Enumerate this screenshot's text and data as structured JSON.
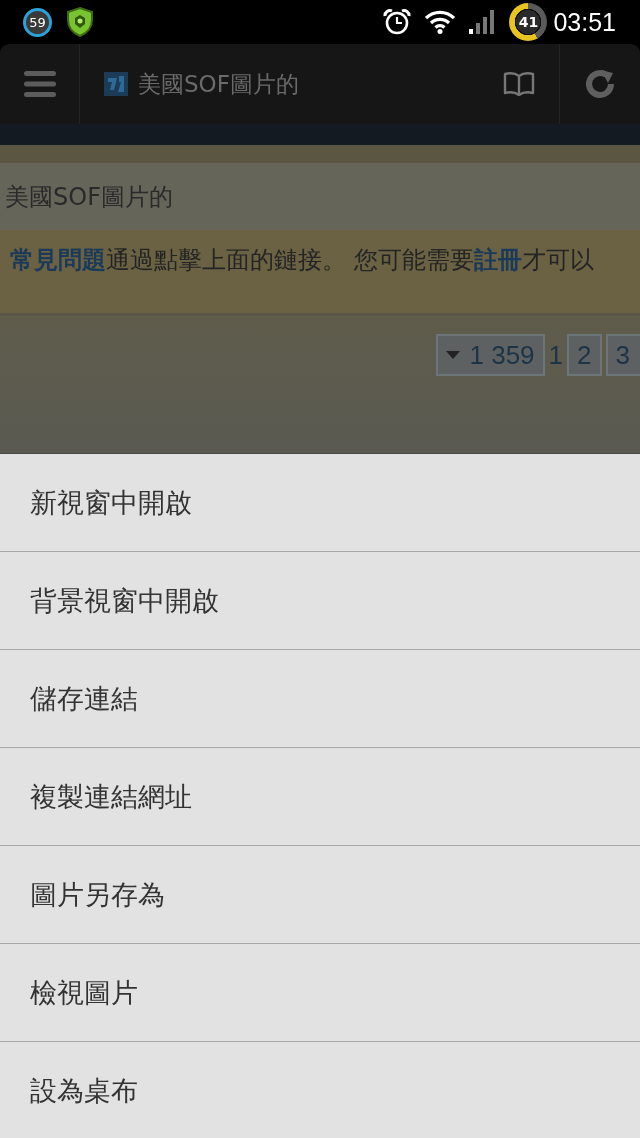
{
  "status_bar": {
    "notification_count": "59",
    "battery": "41",
    "time": "03:51"
  },
  "toolbar": {
    "title": "美國SOF圖片的"
  },
  "page": {
    "title": "美國SOF圖片的",
    "notice": [
      {
        "kind": "link",
        "text": "常見問題"
      },
      {
        "kind": "text",
        "text": "通過點擊上面的鏈接。 您可能需要"
      },
      {
        "kind": "link",
        "text": "註冊"
      },
      {
        "kind": "text",
        "text": "才可以"
      }
    ],
    "pagination": [
      {
        "kind": "jump",
        "label": "1 359"
      },
      {
        "kind": "current",
        "label": "1"
      },
      {
        "kind": "page",
        "label": "2"
      },
      {
        "kind": "page",
        "label": "3"
      }
    ]
  },
  "context_menu": {
    "items": [
      "新視窗中開啟",
      "背景視窗中開啟",
      "儲存連結",
      "複製連結網址",
      "圖片另存為",
      "檢視圖片",
      "設為桌布"
    ]
  }
}
